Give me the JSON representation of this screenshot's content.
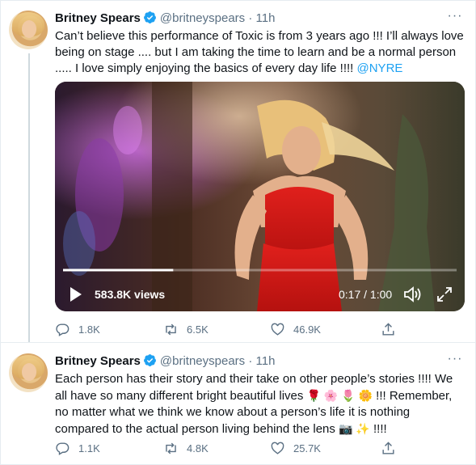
{
  "tweets": [
    {
      "name": "Britney Spears",
      "handle": "@britneyspears",
      "dot": "·",
      "time": "11h",
      "text_parts": [
        "Can’t believe this performance of Toxic is from 3 years ago !!! I’ll always love being on stage .... but I am taking the time to learn and be a normal person ..... I love simply enjoying the basics of every day life !!!! "
      ],
      "mention": "@NYRE",
      "video": {
        "views": "583.8K views",
        "time_display": "0:17 / 1:00",
        "progress": 0.28
      },
      "actions": {
        "replies": "1.8K",
        "retweets": "6.5K",
        "likes": "46.9K"
      }
    },
    {
      "name": "Britney Spears",
      "handle": "@britneyspears",
      "dot": "·",
      "time": "11h",
      "text_a": "Each person has their story and their take on other people’s stories !!!! We all have so many different bright beautiful lives ",
      "emojis_a": "🌹 🌸 🌷 🌼",
      "text_b": "!!! Remember, no matter what we think we know about a person’s life it is nothing compared to the actual person living behind the lens ",
      "emojis_b": "📷 ✨",
      "text_c": " !!!!",
      "actions": {
        "replies": "1.1K",
        "retweets": "4.8K",
        "likes": "25.7K"
      }
    }
  ],
  "colors": {
    "accent": "#1da1f2",
    "muted": "#5b7083",
    "border": "#e6ecf0"
  },
  "icons": [
    "verified-badge-icon",
    "more-options-icon",
    "play-icon",
    "volume-icon",
    "fullscreen-icon",
    "reply-icon",
    "retweet-icon",
    "like-icon",
    "share-icon"
  ]
}
